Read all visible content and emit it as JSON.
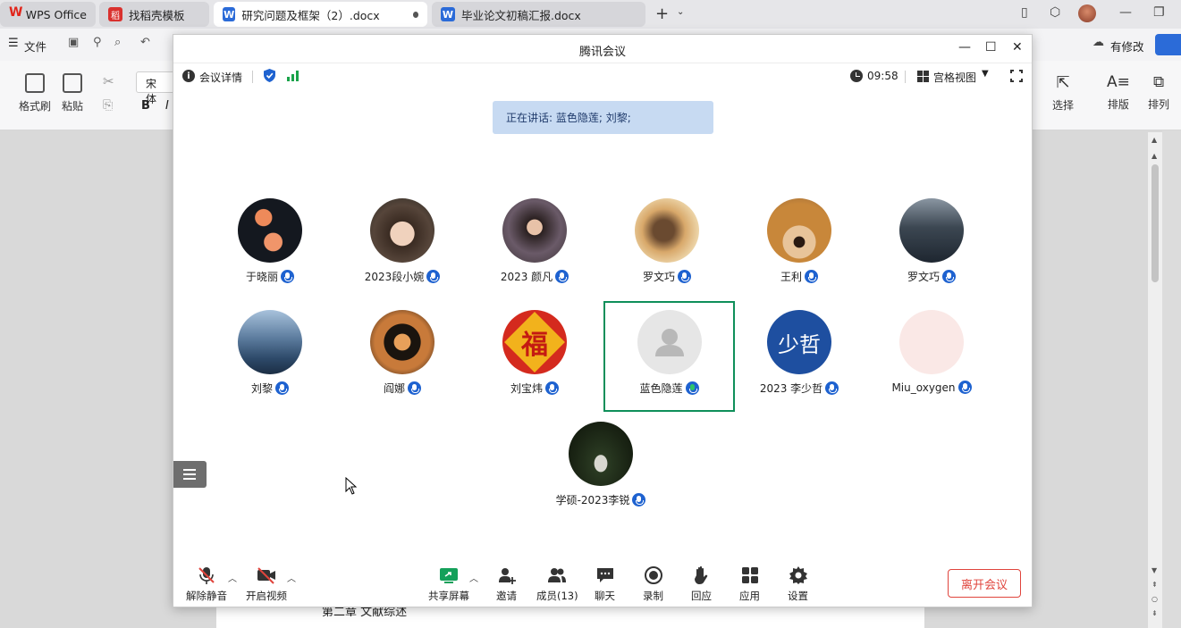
{
  "wps": {
    "tabs": [
      {
        "label": "WPS Office"
      },
      {
        "label": "找稻壳模板"
      },
      {
        "label": "研究问题及框架（2）.docx"
      },
      {
        "label": "毕业论文初稿汇报.docx"
      }
    ],
    "menu": {
      "file": "文件",
      "modified": "有修改"
    },
    "ribbon": {
      "format_painter": "格式刷",
      "paste": "粘贴",
      "font": "宋体",
      "bold": "B",
      "italic": "I",
      "select": "选择",
      "layout": "排版",
      "arrange": "排列"
    },
    "doc_text": "第二章   文献综述"
  },
  "meeting": {
    "title": "腾讯会议",
    "details_label": "会议详情",
    "time": "09:58",
    "view_label": "宫格视图",
    "speaking_banner": "正在讲话: 蓝色隐莲; 刘黎;",
    "participants": [
      {
        "name": "于晓丽"
      },
      {
        "name": "2023段小婉"
      },
      {
        "name": "2023 颜凡"
      },
      {
        "name": "罗文巧"
      },
      {
        "name": "王利"
      },
      {
        "name": "罗文巧"
      },
      {
        "name": "刘黎"
      },
      {
        "name": "阎娜"
      },
      {
        "name": "刘宝炜"
      },
      {
        "name": "蓝色隐莲"
      },
      {
        "name": "2023 李少哲",
        "avatar_text": "少哲"
      },
      {
        "name": "Miu_oxygen"
      },
      {
        "name": "学硕-2023李锐"
      }
    ],
    "controls": {
      "unmute": "解除静音",
      "video": "开启视频",
      "share": "共享屏幕",
      "invite": "邀请",
      "members": "成员(13)",
      "chat": "聊天",
      "record": "录制",
      "react": "回应",
      "apps": "应用",
      "settings": "设置",
      "leave": "离开会议"
    }
  },
  "colors": {
    "accent_blue": "#1e62d0",
    "speaker_border": "#0f8f5a",
    "leave_red": "#e0443c",
    "banner_bg": "#c7daf2"
  }
}
